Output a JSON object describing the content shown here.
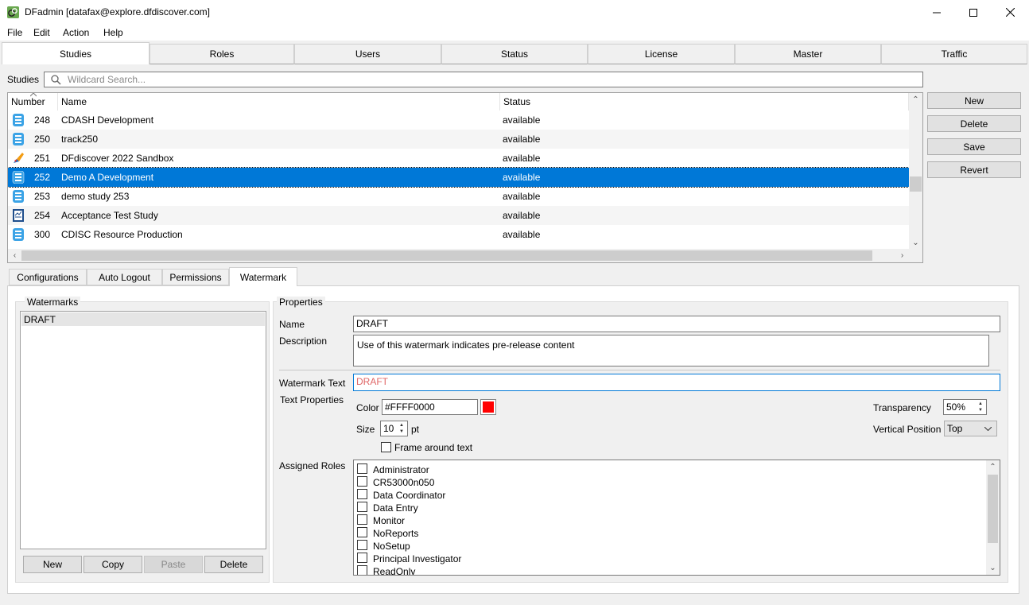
{
  "window": {
    "title": "DFadmin [datafax@explore.dfdiscover.com]",
    "minimize_icon": "minimize-icon",
    "maximize_icon": "maximize-icon",
    "close_icon": "close-icon"
  },
  "menu": [
    "File",
    "Edit",
    "Action",
    "Help"
  ],
  "main_tabs": [
    "Studies",
    "Roles",
    "Users",
    "Status",
    "License",
    "Master",
    "Traffic"
  ],
  "active_main_tab": "Studies",
  "studies": {
    "label": "Studies",
    "search_placeholder": "Wildcard Search...",
    "columns": [
      "Number",
      "Name",
      "Status"
    ],
    "rows": [
      {
        "icon": "database-icon",
        "number": "248",
        "name": "CDASH Development",
        "status": "available"
      },
      {
        "icon": "database-icon",
        "number": "250",
        "name": "track250",
        "status": "available"
      },
      {
        "icon": "sandbox-brush-icon",
        "number": "251",
        "name": "DFdiscover 2022 Sandbox",
        "status": "available"
      },
      {
        "icon": "database-icon",
        "number": "252",
        "name": "Demo A Development",
        "status": "available"
      },
      {
        "icon": "database-icon",
        "number": "253",
        "name": "demo study 253",
        "status": "available"
      },
      {
        "icon": "document-icon",
        "number": "254",
        "name": "Acceptance Test Study",
        "status": "available"
      },
      {
        "icon": "database-icon",
        "number": "300",
        "name": "CDISC Resource Production",
        "status": "available"
      }
    ],
    "selected_number": "252",
    "buttons": [
      "New",
      "Delete",
      "Save",
      "Revert"
    ]
  },
  "sub_tabs": [
    "Configurations",
    "Auto Logout",
    "Permissions",
    "Watermark"
  ],
  "active_sub_tab": "Watermark",
  "watermarks": {
    "group_label": "Watermarks",
    "items": [
      "DRAFT"
    ],
    "buttons": {
      "new": "New",
      "copy": "Copy",
      "paste": "Paste",
      "delete": "Delete"
    }
  },
  "properties": {
    "group_label": "Properties",
    "name_label": "Name",
    "name_value": "DRAFT",
    "description_label": "Description",
    "description_value": "Use of this watermark indicates pre-release content",
    "watermark_text_label": "Watermark Text",
    "watermark_text_value": "DRAFT",
    "text_properties_label": "Text Properties",
    "color_label": "Color",
    "color_value": "#FFFF0000",
    "color_swatch": "#ff0000",
    "watermark_text_color": "#e06666",
    "size_label": "Size",
    "size_value": "10",
    "size_unit": "pt",
    "frame_label": "Frame around text",
    "transparency_label": "Transparency",
    "transparency_value": "50%",
    "vertical_position_label": "Vertical Position",
    "vertical_position_value": "Top",
    "assigned_roles_label": "Assigned Roles",
    "roles": [
      "Administrator",
      "CR53000n050",
      "Data Coordinator",
      "Data Entry",
      "Monitor",
      "NoReports",
      "NoSetup",
      "Principal Investigator",
      "ReadOnly"
    ]
  },
  "colors": {
    "selection": "#0078d7",
    "database_icon": "#3ba3e6"
  }
}
